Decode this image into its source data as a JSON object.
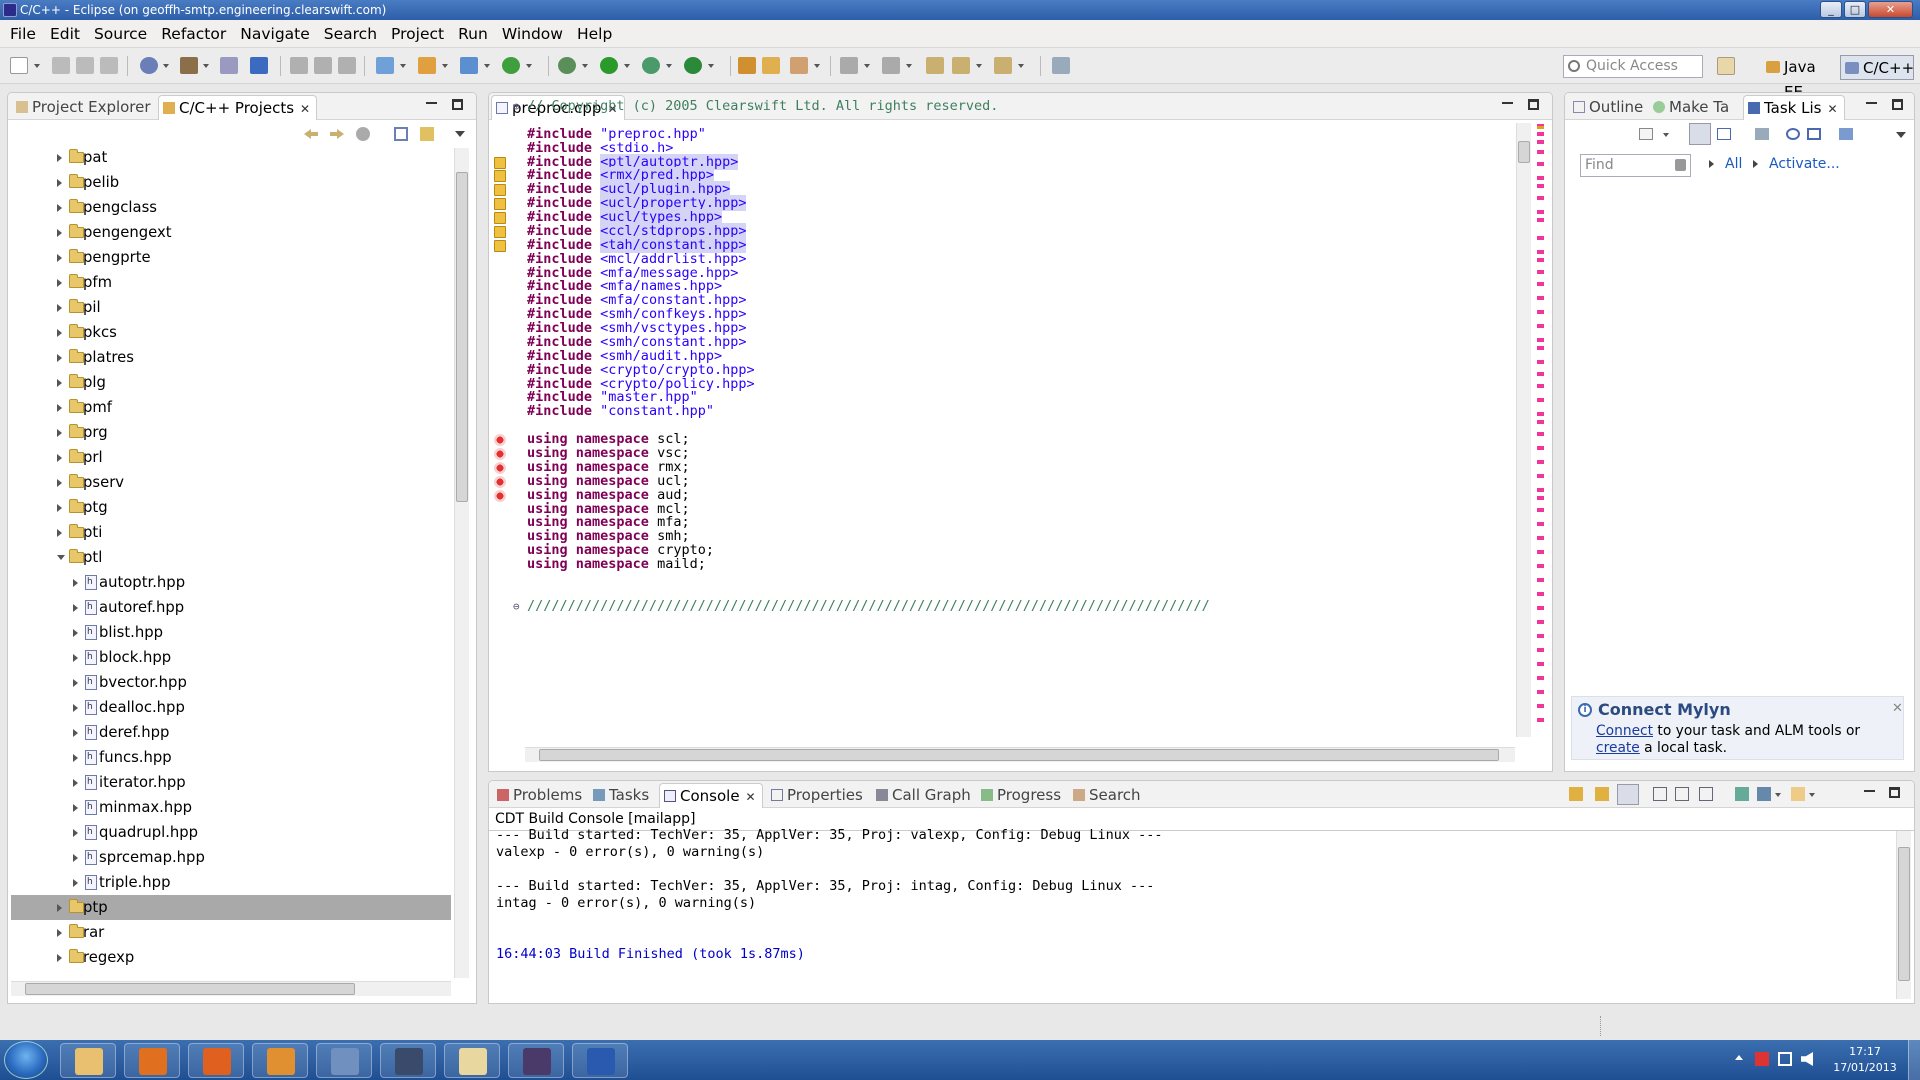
{
  "window": {
    "title": "C/C++ - Eclipse  (on geoffh-smtp.engineering.clearswift.com)"
  },
  "menu": [
    "File",
    "Edit",
    "Source",
    "Refactor",
    "Navigate",
    "Search",
    "Project",
    "Run",
    "Window",
    "Help"
  ],
  "toolbar": {
    "quick_access_placeholder": "Quick Access",
    "perspectives": [
      "Java EE",
      "C/C++"
    ]
  },
  "left_panel": {
    "tabs": [
      "Project Explorer",
      "C/C++ Projects"
    ],
    "tree": [
      {
        "label": "pat",
        "kind": "folder",
        "level": 1,
        "open": false
      },
      {
        "label": "pelib",
        "kind": "folder",
        "level": 1,
        "open": false
      },
      {
        "label": "pengclass",
        "kind": "folder",
        "level": 1,
        "open": false
      },
      {
        "label": "pengengext",
        "kind": "folder",
        "level": 1,
        "open": false
      },
      {
        "label": "pengprte",
        "kind": "folder",
        "level": 1,
        "open": false
      },
      {
        "label": "pfm",
        "kind": "folder",
        "level": 1,
        "open": false
      },
      {
        "label": "pil",
        "kind": "folder",
        "level": 1,
        "open": false
      },
      {
        "label": "pkcs",
        "kind": "folder",
        "level": 1,
        "open": false
      },
      {
        "label": "platres",
        "kind": "folder",
        "level": 1,
        "open": false
      },
      {
        "label": "plg",
        "kind": "folder",
        "level": 1,
        "open": false
      },
      {
        "label": "pmf",
        "kind": "folder",
        "level": 1,
        "open": false
      },
      {
        "label": "prg",
        "kind": "folder",
        "level": 1,
        "open": false
      },
      {
        "label": "prl",
        "kind": "folder",
        "level": 1,
        "open": false
      },
      {
        "label": "pserv",
        "kind": "folder",
        "level": 1,
        "open": false
      },
      {
        "label": "ptg",
        "kind": "folder",
        "level": 1,
        "open": false
      },
      {
        "label": "pti",
        "kind": "folder",
        "level": 1,
        "open": false
      },
      {
        "label": "ptl",
        "kind": "folder",
        "level": 1,
        "open": true
      },
      {
        "label": "autoptr.hpp",
        "kind": "file",
        "level": 2,
        "open": false
      },
      {
        "label": "autoref.hpp",
        "kind": "file",
        "level": 2,
        "open": false
      },
      {
        "label": "blist.hpp",
        "kind": "file",
        "level": 2,
        "open": false
      },
      {
        "label": "block.hpp",
        "kind": "file",
        "level": 2,
        "open": false
      },
      {
        "label": "bvector.hpp",
        "kind": "file",
        "level": 2,
        "open": false
      },
      {
        "label": "dealloc.hpp",
        "kind": "file",
        "level": 2,
        "open": false
      },
      {
        "label": "deref.hpp",
        "kind": "file",
        "level": 2,
        "open": false
      },
      {
        "label": "funcs.hpp",
        "kind": "file",
        "level": 2,
        "open": false
      },
      {
        "label": "iterator.hpp",
        "kind": "file",
        "level": 2,
        "open": false
      },
      {
        "label": "minmax.hpp",
        "kind": "file",
        "level": 2,
        "open": false
      },
      {
        "label": "quadrupl.hpp",
        "kind": "file",
        "level": 2,
        "open": false
      },
      {
        "label": "sprcemap.hpp",
        "kind": "file",
        "level": 2,
        "open": false
      },
      {
        "label": "triple.hpp",
        "kind": "file",
        "level": 2,
        "open": false
      },
      {
        "label": "ptp",
        "kind": "folder",
        "level": 1,
        "open": false,
        "selected": true
      },
      {
        "label": "rar",
        "kind": "folder",
        "level": 1,
        "open": false
      },
      {
        "label": "regexp",
        "kind": "folder",
        "level": 1,
        "open": false
      }
    ]
  },
  "editor": {
    "tab": "preproc.cpp",
    "lines": [
      {
        "kind": "comment",
        "text": "// Copyright (c) 2005 Clearswift Ltd. All rights reserved.",
        "marker": ""
      },
      {
        "kind": "blank",
        "text": "",
        "marker": ""
      },
      {
        "kind": "include",
        "text": "\"preproc.hpp\"",
        "marker": "",
        "hl": false
      },
      {
        "kind": "include",
        "text": "<stdio.h>",
        "marker": "",
        "hl": false
      },
      {
        "kind": "include",
        "text": "<ptl/autoptr.hpp>",
        "marker": "warn",
        "hl": true
      },
      {
        "kind": "include",
        "text": "<rmx/pred.hpp>",
        "marker": "warn",
        "hl": true
      },
      {
        "kind": "include",
        "text": "<ucl/plugin.hpp>",
        "marker": "warn",
        "hl": true
      },
      {
        "kind": "include",
        "text": "<ucl/property.hpp>",
        "marker": "warn",
        "hl": true
      },
      {
        "kind": "include",
        "text": "<ucl/types.hpp>",
        "marker": "warn",
        "hl": true
      },
      {
        "kind": "include",
        "text": "<ccl/stdprops.hpp>",
        "marker": "warn",
        "hl": true
      },
      {
        "kind": "include",
        "text": "<tah/constant.hpp>",
        "marker": "warn",
        "hl": true
      },
      {
        "kind": "include",
        "text": "<mcl/addrlist.hpp>",
        "marker": "",
        "hl": false
      },
      {
        "kind": "include",
        "text": "<mfa/message.hpp>",
        "marker": "",
        "hl": false
      },
      {
        "kind": "include",
        "text": "<mfa/names.hpp>",
        "marker": "",
        "hl": false
      },
      {
        "kind": "include",
        "text": "<mfa/constant.hpp>",
        "marker": "",
        "hl": false
      },
      {
        "kind": "include",
        "text": "<smh/confkeys.hpp>",
        "marker": "",
        "hl": false
      },
      {
        "kind": "include",
        "text": "<smh/vsctypes.hpp>",
        "marker": "",
        "hl": false
      },
      {
        "kind": "include",
        "text": "<smh/constant.hpp>",
        "marker": "",
        "hl": false
      },
      {
        "kind": "include",
        "text": "<smh/audit.hpp>",
        "marker": "",
        "hl": false
      },
      {
        "kind": "include",
        "text": "<crypto/crypto.hpp>",
        "marker": "",
        "hl": false
      },
      {
        "kind": "include",
        "text": "<crypto/policy.hpp>",
        "marker": "",
        "hl": false
      },
      {
        "kind": "include",
        "text": "\"master.hpp\"",
        "marker": "",
        "hl": false
      },
      {
        "kind": "include",
        "text": "\"constant.hpp\"",
        "marker": "",
        "hl": false
      },
      {
        "kind": "blank",
        "text": "",
        "marker": ""
      },
      {
        "kind": "using",
        "text": "scl;",
        "marker": "error"
      },
      {
        "kind": "using",
        "text": "vsc;",
        "marker": "error"
      },
      {
        "kind": "using",
        "text": "rmx;",
        "marker": "error"
      },
      {
        "kind": "using",
        "text": "ucl;",
        "marker": "error"
      },
      {
        "kind": "using",
        "text": "aud;",
        "marker": "error"
      },
      {
        "kind": "using",
        "text": "mcl;",
        "marker": ""
      },
      {
        "kind": "using",
        "text": "mfa;",
        "marker": ""
      },
      {
        "kind": "using",
        "text": "smh;",
        "marker": ""
      },
      {
        "kind": "using",
        "text": "crypto;",
        "marker": ""
      },
      {
        "kind": "using",
        "text": "maild;",
        "marker": ""
      },
      {
        "kind": "blank",
        "text": "",
        "marker": ""
      },
      {
        "kind": "blank",
        "text": "",
        "marker": ""
      },
      {
        "kind": "comment",
        "text": "////////////////////////////////////////////////////////////////////////////////////",
        "marker": ""
      }
    ],
    "include_keyword": "#include",
    "using_keyword": "using",
    "namespace_keyword": "namespace"
  },
  "right_panel": {
    "tabs": [
      "Outline",
      "Make Ta",
      "Task Lis"
    ],
    "find_placeholder": "Find",
    "all_label": "All",
    "activate_label": "Activate...",
    "mylyn": {
      "title": "Connect Mylyn",
      "connect_link": "Connect",
      "text1": " to your task and ALM tools or",
      "create_link": "create",
      "text2": " a local task."
    }
  },
  "bottom_panel": {
    "tabs": [
      "Problems",
      "Tasks",
      "Console",
      "Properties",
      "Call Graph",
      "Progress",
      "Search"
    ],
    "console_title": "CDT Build Console [mailapp]",
    "lines": [
      {
        "text": "--- Build started: TechVer: 35, ApplVer: 35, Proj: valexp, Config: Debug Linux ---",
        "color": "#000000"
      },
      {
        "text": "valexp - 0 error(s), 0 warning(s)",
        "color": "#000000"
      },
      {
        "text": "",
        "color": "#000000"
      },
      {
        "text": "--- Build started: TechVer: 35, ApplVer: 35, Proj: intag, Config: Debug Linux ---",
        "color": "#000000"
      },
      {
        "text": "intag - 0 error(s), 0 warning(s)",
        "color": "#000000"
      },
      {
        "text": "",
        "color": "#000000"
      },
      {
        "text": "",
        "color": "#000000"
      },
      {
        "text": "16:44:03 Build Finished (took 1s.87ms)",
        "color": "#0000cc"
      }
    ]
  },
  "taskbar": {
    "apps": [
      "explorer",
      "media-player",
      "firefox",
      "outlook",
      "virtualbox",
      "remote-desktop",
      "notepad",
      "java-ee-ide",
      "word"
    ],
    "time": "17:17",
    "date": "17/01/2013"
  }
}
